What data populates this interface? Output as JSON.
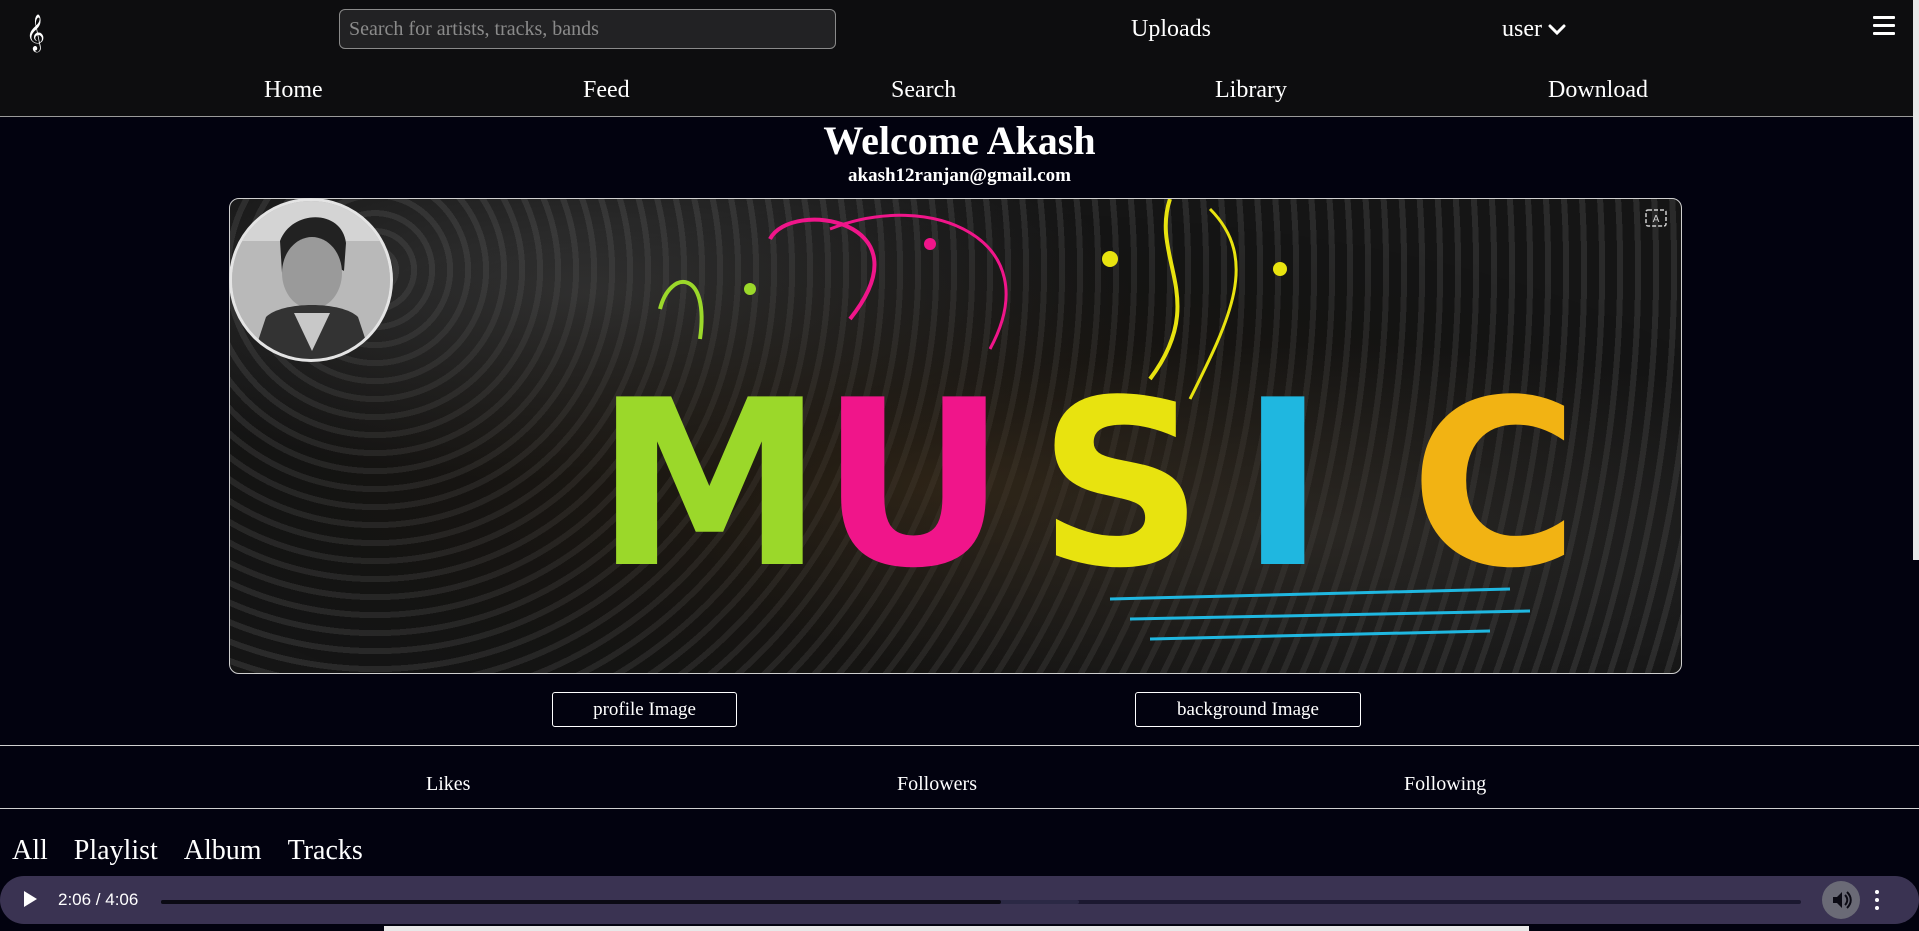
{
  "header": {
    "logo_icon": "treble-clef-icon",
    "logo_glyph": "𝄞",
    "search": {
      "placeholder": "Search for artists, tracks, bands",
      "value": ""
    },
    "uploads_label": "Uploads",
    "user_label": "user",
    "menu_icon": "hamburger-icon"
  },
  "nav": {
    "items": [
      "Home",
      "Feed",
      "Search",
      "Library",
      "Download"
    ]
  },
  "profile": {
    "welcome": "Welcome Akash",
    "email": "akash12ranjan@gmail.com",
    "banner_text": [
      "M",
      "U",
      "S",
      "I",
      "C"
    ],
    "banner_colors": [
      "#9bd82a",
      "#f0158a",
      "#e8e30f",
      "#1fb7e0",
      "#f2b313"
    ],
    "profile_image_button": "profile Image",
    "background_image_button": "background Image"
  },
  "stats": {
    "likes": "Likes",
    "followers": "Followers",
    "following": "Following"
  },
  "tabs": [
    "All",
    "Playlist",
    "Album",
    "Tracks"
  ],
  "player": {
    "time": "2:06 / 4:06",
    "progress": 0.512,
    "buffered": 0.56
  },
  "colors": {
    "background": "#02020f",
    "bar": "#0d0d0f",
    "player": "#3a3352"
  }
}
